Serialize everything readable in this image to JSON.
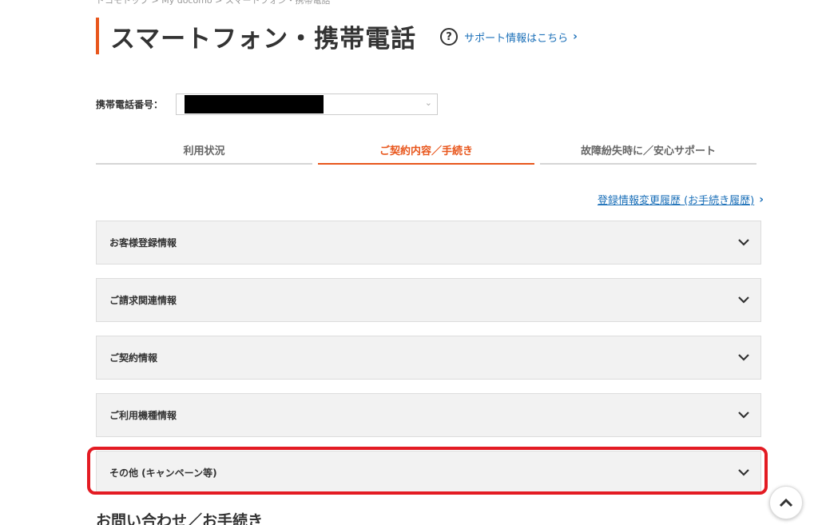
{
  "breadcrumb": "ドコモトップ  >  My docomo  >  スマートフォン・携帯電話",
  "header": {
    "title": "スマートフォン・携帯電話",
    "support_label": "サポート情報はこちら",
    "help_icon": "help-circle-icon",
    "accent_color": "#e8561c"
  },
  "phone": {
    "label": "携帯電話番号：",
    "value_redacted": true
  },
  "tabs": [
    {
      "label": "利用状況",
      "active": false
    },
    {
      "label": "ご契約内容／手続き",
      "active": true
    },
    {
      "label": "故障紛失時に／安心サポート",
      "active": false
    }
  ],
  "history_link": {
    "label": "登録情報変更履歴 (お手続き履歴)"
  },
  "accordions": [
    {
      "label": "お客様登録情報"
    },
    {
      "label": "ご請求関連情報"
    },
    {
      "label": "ご契約情報"
    },
    {
      "label": "ご利用機種情報"
    },
    {
      "label": "その他 (キャンペーン等)",
      "highlighted": true
    }
  ],
  "section_heading": "お問い合わせ／お手続き",
  "colors": {
    "link": "#1a6fb8",
    "highlight": "#e31b23",
    "panel": "#f2f2f2"
  }
}
